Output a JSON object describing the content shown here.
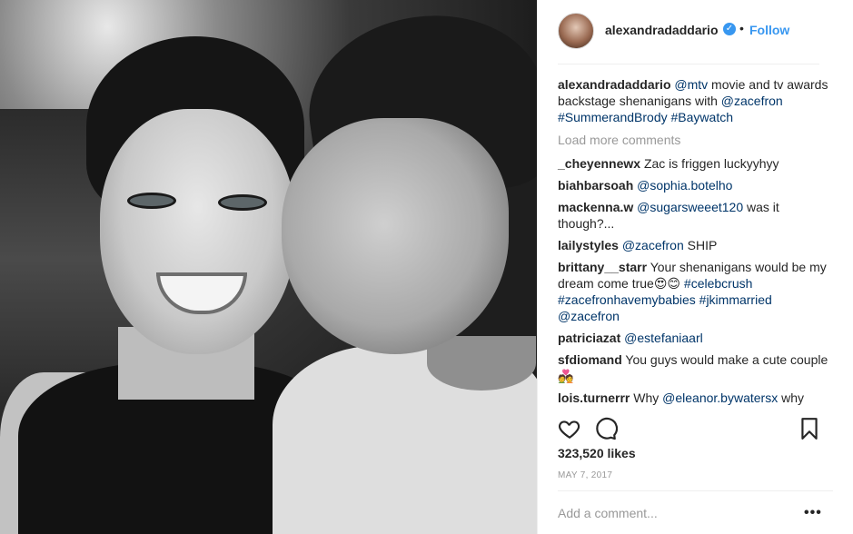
{
  "post": {
    "username": "alexandradaddario",
    "separator": "•",
    "follow_label": "Follow"
  },
  "caption": {
    "user": "alexandradaddario",
    "mention": "@mtv",
    "text": " movie and tv awards backstage shenanigans with ",
    "tags": [
      "@zacefron",
      "#SummerandBrody",
      "#Baywatch"
    ]
  },
  "load_more": "Load more comments",
  "comments": [
    {
      "user": "_cheyennewx",
      "text": "Zac is friggen luckyyhyy"
    },
    {
      "user": "biahbarsoah",
      "mention": "@sophia.botelho"
    },
    {
      "user": "mackenna.w",
      "mention": "@sugarsweeet120",
      "text": " was it though?..."
    },
    {
      "user": "lailystyles",
      "mention": "@zacefron",
      "text": " SHIP"
    },
    {
      "user": "brittany__starr",
      "text": "Your shenanigans would be my dream come true😍😊 ",
      "tags": [
        "#celebcrush",
        "#zacefronhavemybabies",
        "#jkimmarried",
        "@zacefron"
      ]
    },
    {
      "user": "patriciazat",
      "mention": "@estefaniaarl"
    },
    {
      "user": "sfdiomand",
      "text": "You guys would make a cute couple💑"
    },
    {
      "user": "lois.turnerrr",
      "text": "Why ",
      "mention": "@eleanor.bywatersx",
      "text2": " why"
    }
  ],
  "likes": "323,520 likes",
  "date": "MAY 7, 2017",
  "add_comment_placeholder": "Add a comment...",
  "more_options": "•••",
  "icons": [
    "heart-icon",
    "comment-icon",
    "bookmark-icon",
    "verified-badge-icon"
  ],
  "colors": {
    "accent": "#3897f0",
    "link": "#003569",
    "muted": "#999999"
  }
}
